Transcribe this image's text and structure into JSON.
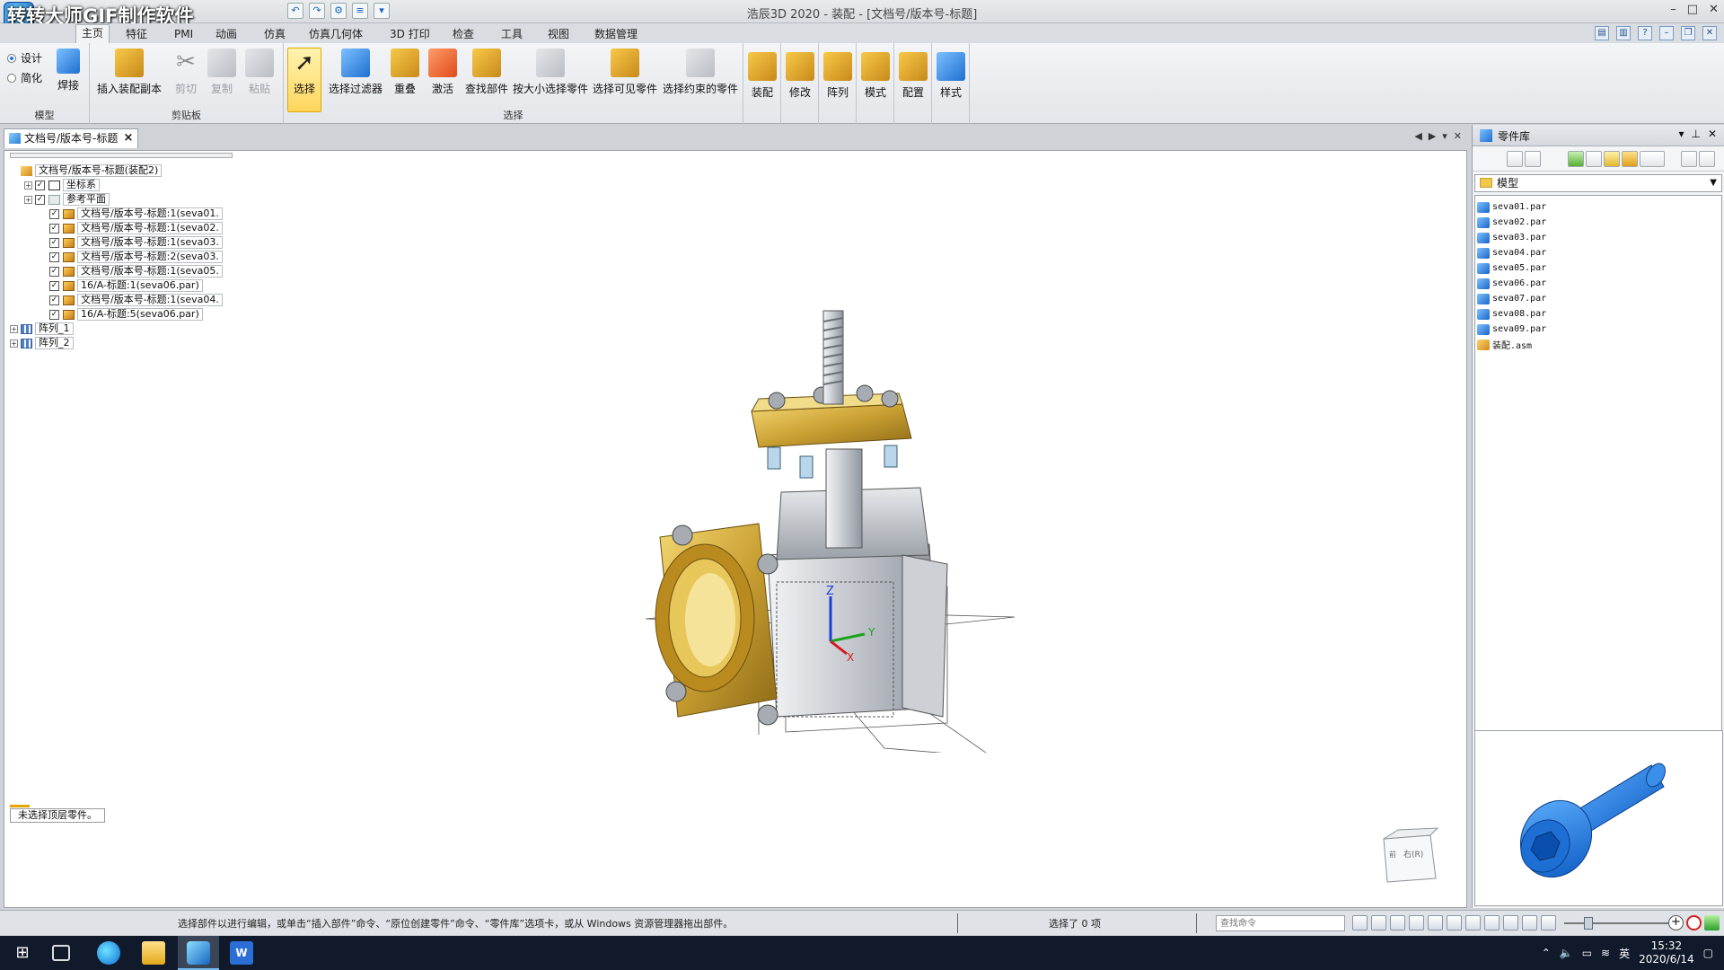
{
  "watermark": "转转大师GIF制作软件",
  "window_title": "浩辰3D 2020 - 装配 - [文档号/版本号-标题]",
  "ribbon_tabs": [
    "主页",
    "特征",
    "PMI",
    "动画",
    "仿真",
    "仿真几何体",
    "3D 打印",
    "检查",
    "工具",
    "视图",
    "数据管理"
  ],
  "ribbon": {
    "model_group": {
      "radio_design": "设计",
      "radio_simplify": "简化",
      "weld": "焊接",
      "label": "模型"
    },
    "clipboard_group": {
      "insert_copy": "插入装配副本",
      "cut": "剪切",
      "copy": "复制",
      "paste": "粘贴",
      "label": "剪贴板"
    },
    "select_group": {
      "select": "选择",
      "select_filter": "选择过滤器",
      "overlap": "重叠",
      "activate": "激活",
      "find_part": "查找部件",
      "select_by_size": "按大小选择零件",
      "select_visible": "选择可见零件",
      "select_constrained": "选择约束的零件",
      "label": "选择"
    },
    "assemble": "装配",
    "modify": "修改",
    "pattern": "阵列",
    "mold": "模式",
    "config": "配置",
    "style": "样式"
  },
  "doc_tab": {
    "title": "文档号/版本号-标题",
    "close": "×"
  },
  "tree": [
    {
      "label": "文档号/版本号-标题(装配2)",
      "level": 0,
      "icon": "assembly",
      "expander": "",
      "check": false
    },
    {
      "label": "坐标系",
      "level": 1,
      "icon": "coord",
      "expander": "+",
      "check": true
    },
    {
      "label": "参考平面",
      "level": 1,
      "icon": "plane",
      "expander": "+",
      "check": true
    },
    {
      "label": "文档号/版本号-标题:1(seva01.",
      "level": 2,
      "icon": "part",
      "expander": "",
      "check": true
    },
    {
      "label": "文档号/版本号-标题:1(seva02.",
      "level": 2,
      "icon": "part",
      "expander": "",
      "check": true
    },
    {
      "label": "文档号/版本号-标题:1(seva03.",
      "level": 2,
      "icon": "part",
      "expander": "",
      "check": true
    },
    {
      "label": "文档号/版本号-标题:2(seva03.",
      "level": 2,
      "icon": "part",
      "expander": "",
      "check": true
    },
    {
      "label": "文档号/版本号-标题:1(seva05.",
      "level": 2,
      "icon": "part",
      "expander": "",
      "check": true
    },
    {
      "label": "16/A-标题:1(seva06.par)",
      "level": 2,
      "icon": "part",
      "expander": "",
      "check": true
    },
    {
      "label": "文档号/版本号-标题:1(seva04.",
      "level": 2,
      "icon": "part",
      "expander": "",
      "check": true
    },
    {
      "label": "16/A-标题:5(seva06.par)",
      "level": 2,
      "icon": "part",
      "expander": "",
      "check": true
    },
    {
      "label": "阵列_1",
      "level": 0,
      "icon": "pattern",
      "expander": "+",
      "check": false
    },
    {
      "label": "阵列_2",
      "level": 0,
      "icon": "pattern",
      "expander": "+",
      "check": false
    }
  ],
  "status_hint": "未选择顶层零件。",
  "axes": {
    "z": "Z",
    "y": "Y",
    "x": "X"
  },
  "view_cube": {
    "top": "前",
    "face": "右(R)"
  },
  "library": {
    "title": "零件库",
    "folder": "模型",
    "items": [
      {
        "name": "seva01.par",
        "type": "part"
      },
      {
        "name": "seva02.par",
        "type": "part"
      },
      {
        "name": "seva03.par",
        "type": "part"
      },
      {
        "name": "seva04.par",
        "type": "part"
      },
      {
        "name": "seva05.par",
        "type": "part"
      },
      {
        "name": "seva06.par",
        "type": "part"
      },
      {
        "name": "seva07.par",
        "type": "part"
      },
      {
        "name": "seva08.par",
        "type": "part"
      },
      {
        "name": "seva09.par",
        "type": "part"
      },
      {
        "name": "装配.asm",
        "type": "assembly"
      }
    ]
  },
  "statusbar": {
    "message": "选择部件以进行编辑，或单击“插入部件”命令、“原位创建零件”命令、“零件库”选项卡，或从 Windows 资源管理器拖出部件。",
    "selection_count": "选择了 0 项",
    "search_placeholder": "查找命令"
  },
  "taskbar": {
    "time": "15:32",
    "date": "2020/6/14",
    "ime": "英"
  },
  "colors": {
    "accent": "#1e6fd0",
    "brass": "#d4a62a",
    "select_highlight": "#ffd65c"
  }
}
